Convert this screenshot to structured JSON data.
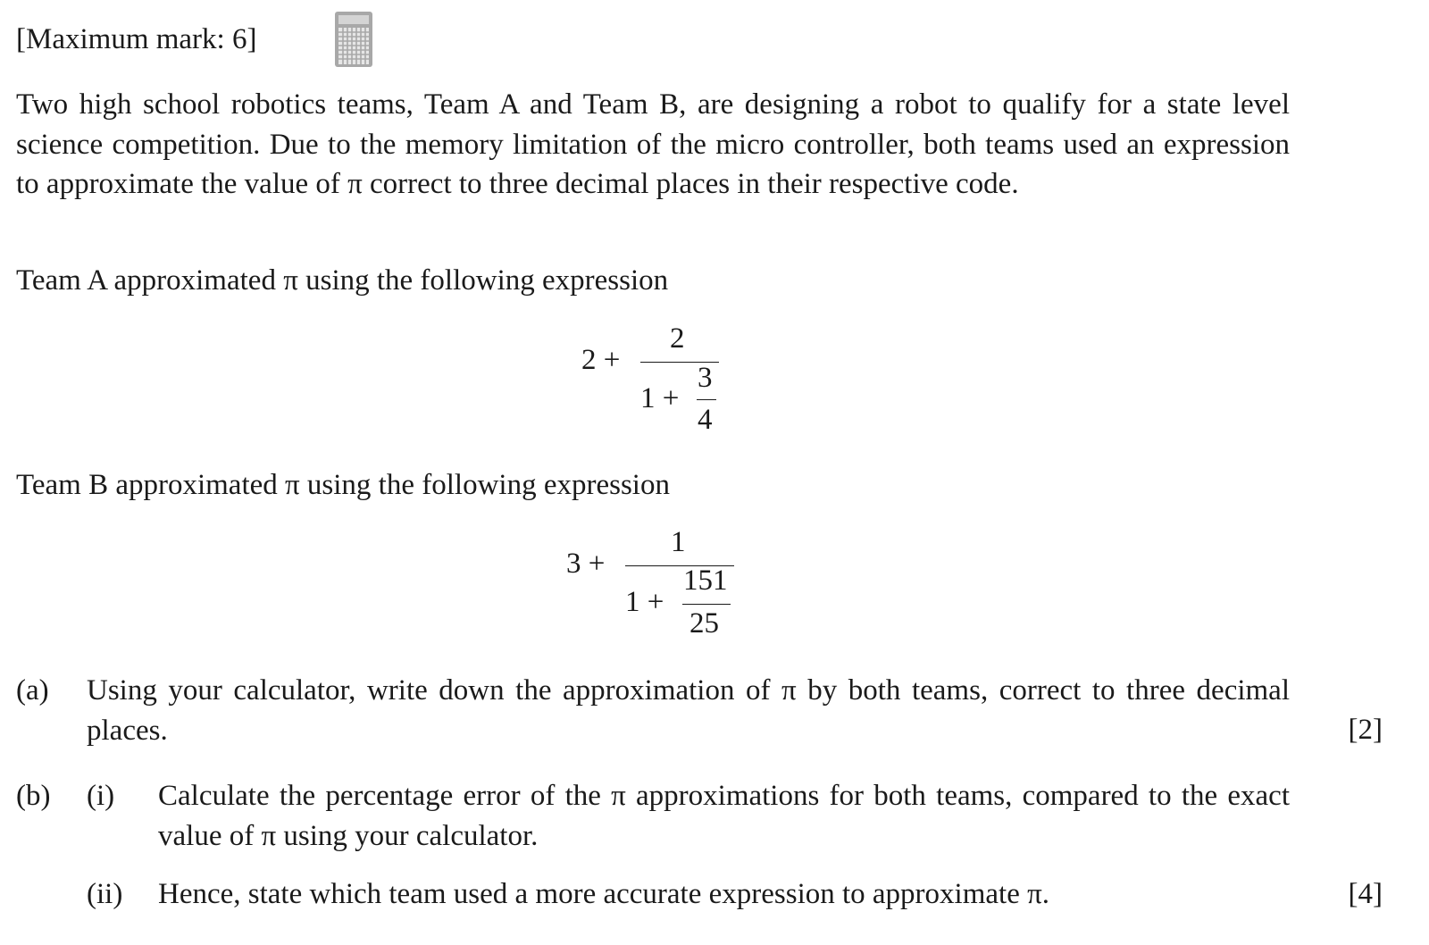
{
  "header": {
    "max_mark": "[Maximum mark: 6]",
    "calculator_icon": "calculator-icon"
  },
  "intro": {
    "text": "Two high school robotics teams, Team A and Team B, are designing a robot to qualify for a state level science competition. Due to the memory limitation of the micro controller, both teams used an expression to approximate the value of π correct to three decimal places in their respective code."
  },
  "team_a": {
    "label": "Team A approximated π using the following expression",
    "expr": {
      "lead": "2 +",
      "numerator": "2",
      "inner_lead": "1 +",
      "inner_num": "3",
      "inner_den": "4"
    }
  },
  "team_b": {
    "label": "Team B approximated π using the following expression",
    "expr": {
      "lead": "3 +",
      "numerator": "1",
      "inner_lead": "1 +",
      "inner_num": "151",
      "inner_den": "25"
    }
  },
  "parts": {
    "a": {
      "label": "(a)",
      "text": "Using your calculator, write down the approximation of π by both teams, correct to three decimal places.",
      "mark": "[2]"
    },
    "b": {
      "label": "(b)",
      "i": {
        "label": "(i)",
        "text": "Calculate the percentage error of the π approximations for both teams, compared to the exact value of π using your calculator."
      },
      "ii": {
        "label": "(ii)",
        "text": "Hence, state which team used a more accurate expression to approximate π."
      },
      "mark": "[4]"
    }
  }
}
